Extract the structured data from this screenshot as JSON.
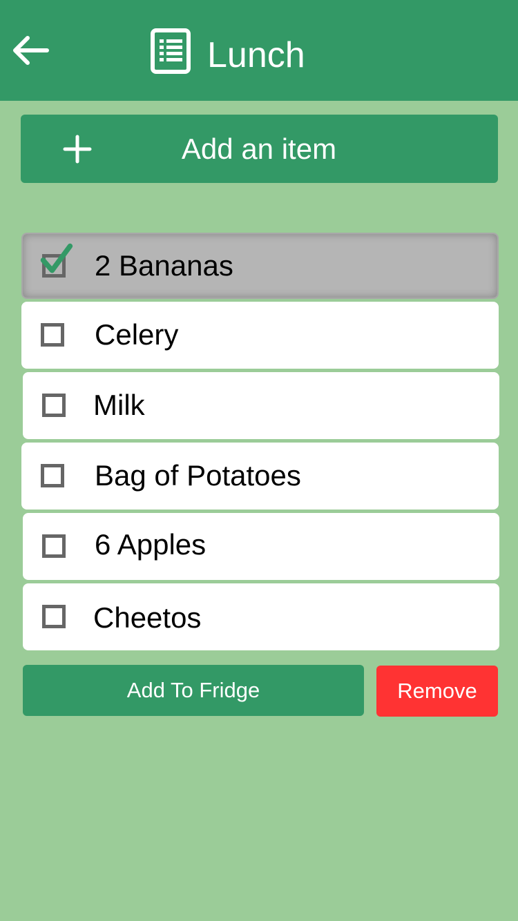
{
  "header": {
    "title": "Lunch",
    "back_icon": "arrow-left-icon",
    "title_icon": "list-document-icon",
    "background": "#339966"
  },
  "add_item": {
    "label": "Add an item",
    "icon": "plus-icon"
  },
  "items": [
    {
      "label": "2 Bananas",
      "checked": true
    },
    {
      "label": "Celery",
      "checked": false
    },
    {
      "label": "Milk",
      "checked": false
    },
    {
      "label": "Bag of Potatoes",
      "checked": false
    },
    {
      "label": "6 Apples",
      "checked": false
    },
    {
      "label": "Cheetos",
      "checked": false
    }
  ],
  "actions": {
    "add_to_fridge": "Add To Fridge",
    "remove": "Remove"
  },
  "colors": {
    "background": "#9bcc98",
    "accent": "#339966",
    "danger": "#ff3333",
    "selected_row": "#b5b5b5"
  }
}
